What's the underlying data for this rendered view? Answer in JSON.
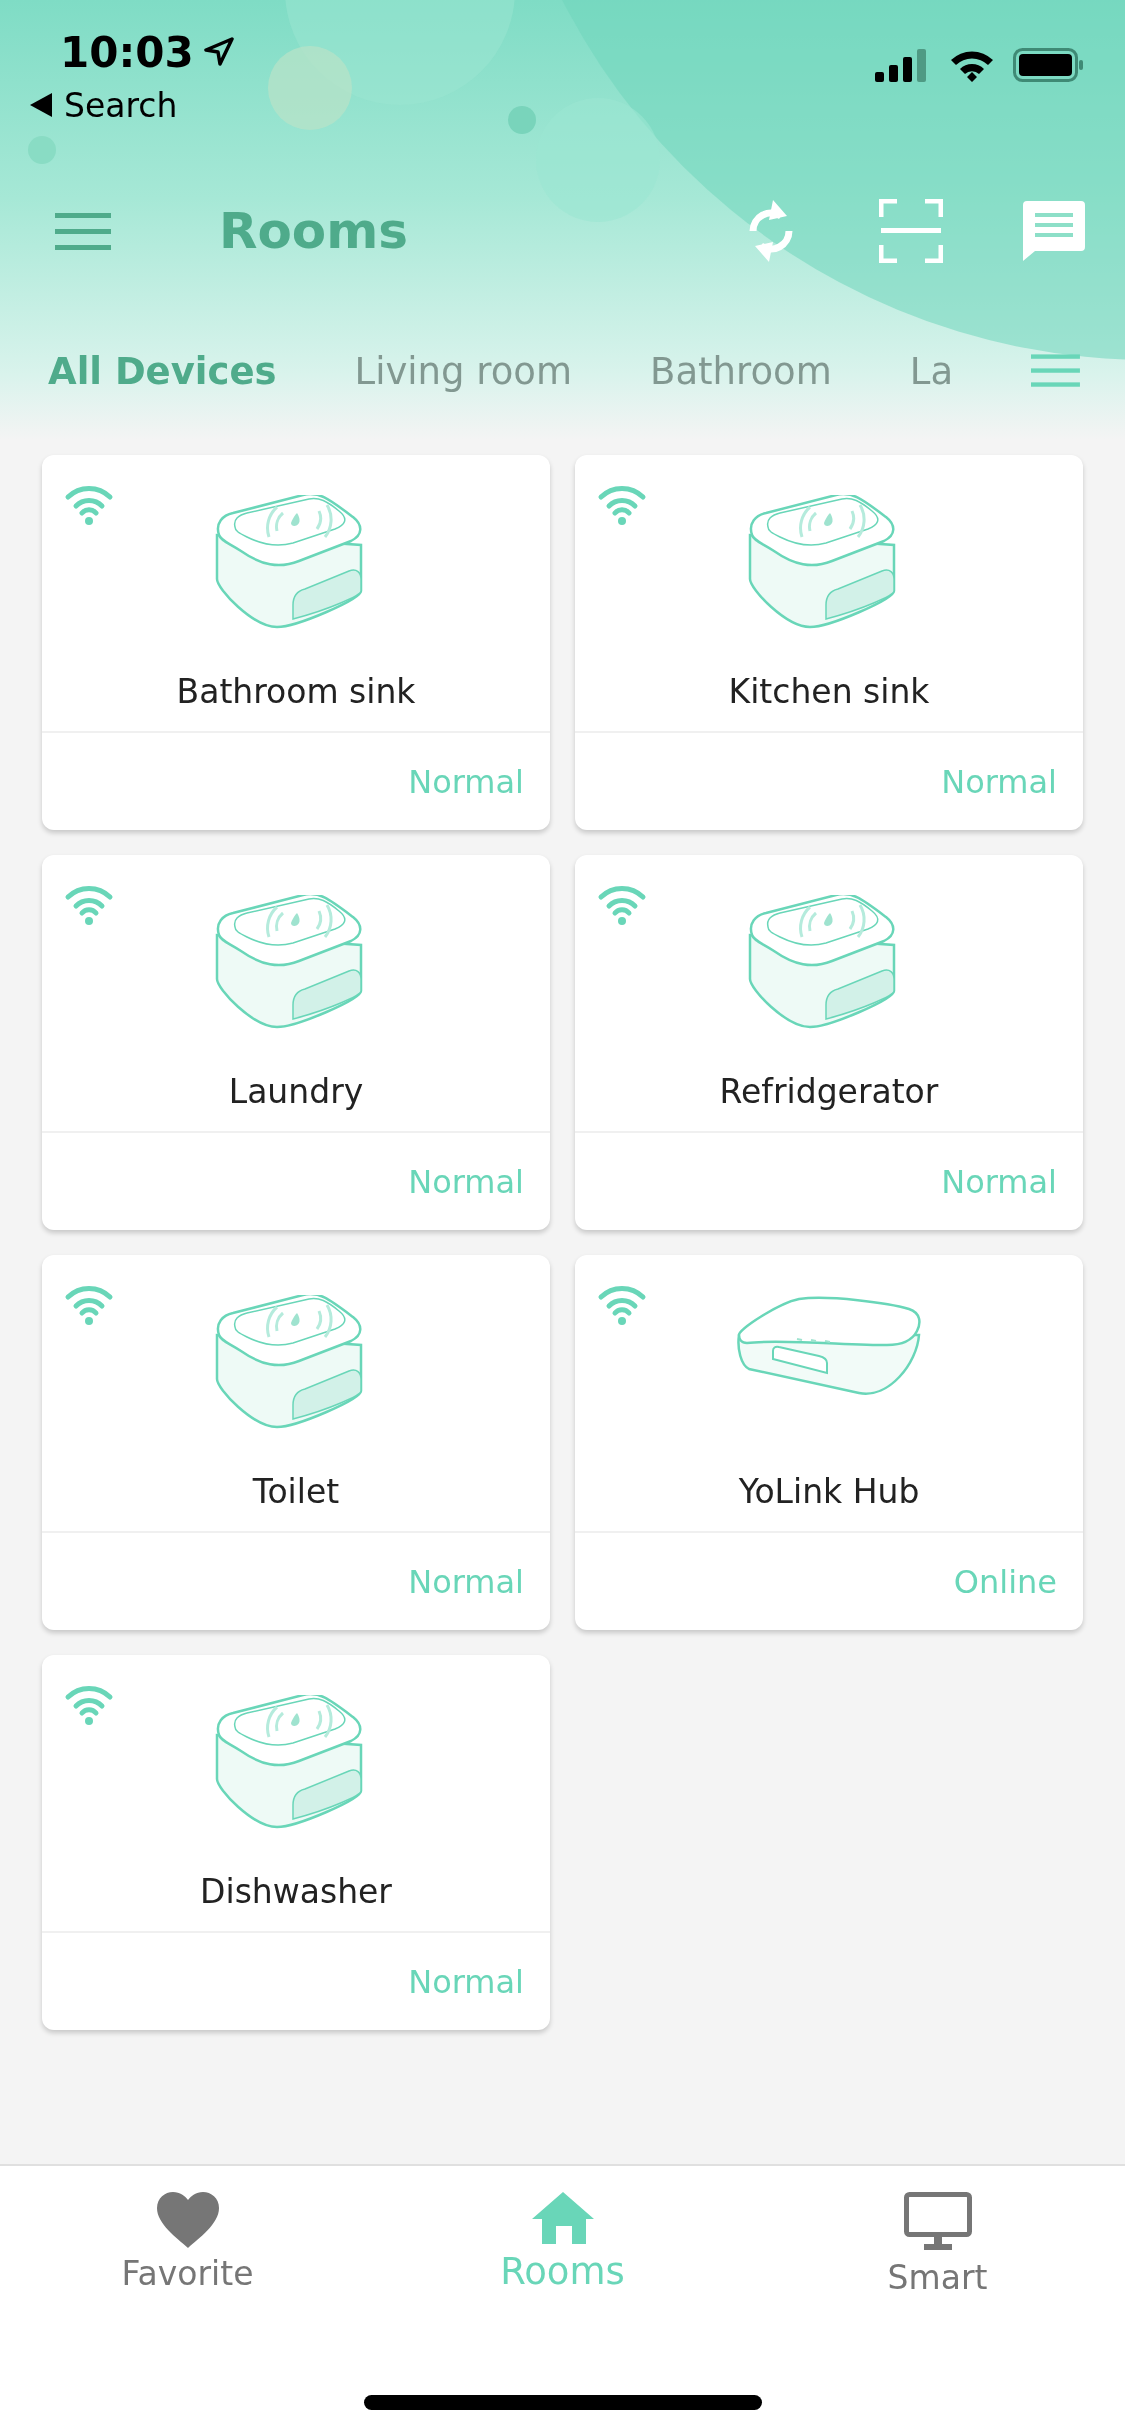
{
  "status_bar": {
    "time": "10:03",
    "back_label": "Search"
  },
  "header": {
    "title": "Rooms"
  },
  "tabs": [
    {
      "label": "All Devices",
      "selected": true
    },
    {
      "label": "Living room",
      "selected": false
    },
    {
      "label": "Bathroom",
      "selected": false
    },
    {
      "label": "La",
      "selected": false
    }
  ],
  "devices": [
    {
      "name": "Bathroom sink",
      "status": "Normal",
      "kind": "sensor"
    },
    {
      "name": "Kitchen sink",
      "status": "Normal",
      "kind": "sensor"
    },
    {
      "name": "Laundry",
      "status": "Normal",
      "kind": "sensor"
    },
    {
      "name": "Refridgerator",
      "status": "Normal",
      "kind": "sensor"
    },
    {
      "name": "Toilet",
      "status": "Normal",
      "kind": "sensor"
    },
    {
      "name": "YoLink Hub",
      "status": "Online",
      "kind": "hub"
    },
    {
      "name": "Dishwasher",
      "status": "Normal",
      "kind": "sensor"
    }
  ],
  "nav": [
    {
      "label": "Favorite",
      "kind": "heart",
      "selected": false
    },
    {
      "label": "Rooms",
      "kind": "home",
      "selected": true
    },
    {
      "label": "Smart",
      "kind": "monitor",
      "selected": false
    }
  ]
}
